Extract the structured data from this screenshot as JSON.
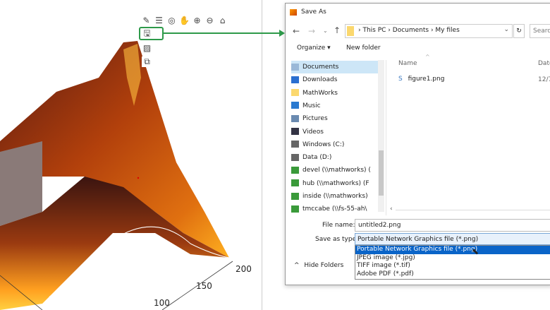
{
  "figure": {
    "toolbar": [
      "brush-icon",
      "legend-icon",
      "rotate-icon",
      "pan-icon",
      "zoom-in-icon",
      "zoom-out-icon",
      "home-icon"
    ],
    "export_menu": [
      "save-icon",
      "copy-image-icon",
      "copy-vector-icon"
    ],
    "axis_ticks": [
      "200",
      "150",
      "100"
    ],
    "highlight_color": "#2e9a4a"
  },
  "dialog": {
    "title": "Save As",
    "address": [
      "This PC",
      "Documents",
      "My files"
    ],
    "search_placeholder": "Searc",
    "organize": "Organize ▾",
    "new_folder": "New folder",
    "nav": [
      {
        "label": "Documents",
        "icon": "documents-icon",
        "selected": true
      },
      {
        "label": "Downloads",
        "icon": "downloads-icon"
      },
      {
        "label": "MathWorks",
        "icon": "folder-icon"
      },
      {
        "label": "Music",
        "icon": "music-icon"
      },
      {
        "label": "Pictures",
        "icon": "pictures-icon"
      },
      {
        "label": "Videos",
        "icon": "videos-icon"
      },
      {
        "label": "Windows (C:)",
        "icon": "drive-icon"
      },
      {
        "label": "Data (D:)",
        "icon": "drive-icon"
      },
      {
        "label": "devel (\\\\mathworks) (",
        "icon": "network-drive-icon"
      },
      {
        "label": "hub (\\\\mathworks) (F",
        "icon": "network-drive-icon"
      },
      {
        "label": "inside (\\\\mathworks)",
        "icon": "network-drive-icon"
      },
      {
        "label": "tmccabe (\\\\fs-55-ah\\",
        "icon": "network-drive-icon"
      }
    ],
    "columns": {
      "name": "Name",
      "date": "Date"
    },
    "files": [
      {
        "name": "figure1.png",
        "date": "12/7"
      }
    ],
    "file_name_label": "File name:",
    "file_name": "untitled2.png",
    "save_type_label": "Save as type:",
    "save_type": "Portable Network Graphics file (*.png)",
    "type_options": [
      "Portable Network Graphics file (*.png)",
      "JPEG image (*.jpg)",
      "TIFF image (*.tif)",
      "Adobe PDF (*.pdf)"
    ],
    "hide_folders": "Hide Folders"
  }
}
